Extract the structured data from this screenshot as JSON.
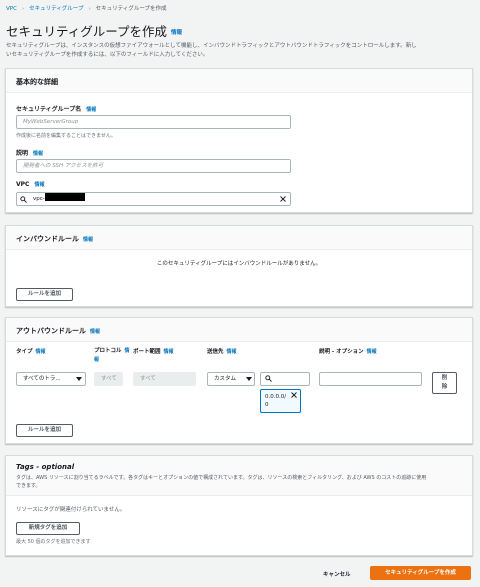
{
  "breadcrumb": {
    "items": [
      "VPC",
      "セキュリティグループ",
      "セキュリティグループを作成"
    ]
  },
  "page": {
    "title": "セキュリティグループを作成",
    "info": "情報",
    "description_line1": "セキュリティグループは、インスタンスの仮想ファイアウォールとして機能し、インバウンドトラフィックとアウトバウンドトラフィックをコントロールします。新し",
    "description_line2": "いセキュリティグループを作成するには、以下のフィールドに入力してください。"
  },
  "basic": {
    "title": "基本的な詳細",
    "name_label": "セキュリティグループ名",
    "name_info": "情報",
    "name_placeholder": "MyWebServerGroup",
    "name_hint": "作成後に名前を編集することはできません。",
    "desc_label": "説明",
    "desc_info": "情報",
    "desc_placeholder": "開発者への SSH アクセスを許可",
    "vpc_label": "VPC",
    "vpc_info": "情報",
    "vpc_value": "vpc-"
  },
  "inbound": {
    "title": "インバウンドルール",
    "info": "情報",
    "empty_text": "このセキュリティグループにはインバウンドルールがありません。",
    "add_button": "ルールを追加"
  },
  "outbound": {
    "title": "アウトバウンドルール",
    "info": "情報",
    "columns": {
      "type": "タイプ",
      "type_info": "情報",
      "protocol": "プロトコル",
      "protocol_info": "情報",
      "port": "ポート範囲",
      "port_info": "情報",
      "dest": "送信先",
      "dest_info": "情報",
      "desc": "説明 - オプション",
      "desc_info": "情報"
    },
    "rule": {
      "type": "すべてのトラ...",
      "protocol": "すべて",
      "port": "すべて",
      "dest": "カスタム",
      "cidr": "0.0.0.0/0",
      "delete": "削除"
    },
    "add_button": "ルールを追加"
  },
  "tags": {
    "title": "Tags - optional",
    "description_line1": "タグは、AWS リソースに割り当てるラベルです。各タグはキーとオプションの値で構成されています。タグは、リソースの検索とフィルタリング、および AWS のコストの追跡に使用",
    "description_line2": "できます。",
    "empty_text": "リソースにタグが関連付けられていません。",
    "add_button": "新規タグを追加",
    "limit_text": "最大 50 個のタグを追加できます"
  },
  "footer": {
    "cancel": "キャンセル",
    "create": "セキュリティグループを作成"
  },
  "colors": {
    "primary": "#ec7211",
    "link": "#0073bb",
    "background": "#f2f3f3"
  }
}
